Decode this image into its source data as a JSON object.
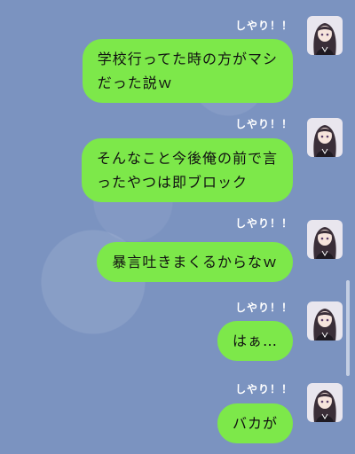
{
  "messages": [
    {
      "sender": "しやり！！",
      "text": "学校行ってた時の方がマシ\nだった説ｗ",
      "avatar_icon": "anime-girl-avatar-icon"
    },
    {
      "sender": "しやり！！",
      "text": "そんなこと今後俺の前で言\nったやつは即ブロック",
      "avatar_icon": "anime-girl-avatar-icon"
    },
    {
      "sender": "しやり！！",
      "text": "暴言吐きまくるからなｗ",
      "avatar_icon": "anime-girl-avatar-icon"
    },
    {
      "sender": "しやり！！",
      "text": "はぁ…",
      "avatar_icon": "anime-girl-avatar-icon"
    },
    {
      "sender": "しやり！！",
      "text": "バカが",
      "avatar_icon": "anime-girl-avatar-icon"
    }
  ],
  "colors": {
    "background": "#7b93c0",
    "bubble": "#7de84a",
    "sender_name": "#ffffff"
  }
}
